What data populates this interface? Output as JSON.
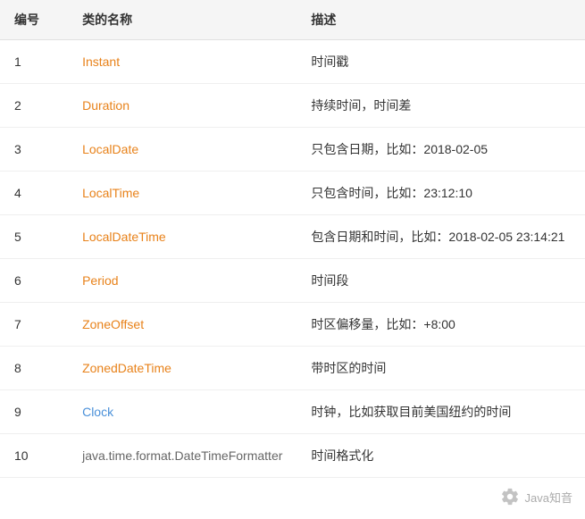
{
  "table": {
    "headers": [
      "编号",
      "类的名称",
      "描述"
    ],
    "rows": [
      {
        "id": "1",
        "class_name": "Instant",
        "class_color": "orange",
        "description": "时间戳"
      },
      {
        "id": "2",
        "class_name": "Duration",
        "class_color": "orange",
        "description": "持续时间，时间差"
      },
      {
        "id": "3",
        "class_name": "LocalDate",
        "class_color": "orange",
        "description": "只包含日期，比如：2018-02-05"
      },
      {
        "id": "4",
        "class_name": "LocalTime",
        "class_color": "orange",
        "description": "只包含时间，比如：23:12:10"
      },
      {
        "id": "5",
        "class_name": "LocalDateTime",
        "class_color": "orange",
        "description": "包含日期和时间，比如：2018-02-05 23:14:21"
      },
      {
        "id": "6",
        "class_name": "Period",
        "class_color": "orange",
        "description": "时间段"
      },
      {
        "id": "7",
        "class_name": "ZoneOffset",
        "class_color": "orange",
        "description": "时区偏移量，比如：+8:00"
      },
      {
        "id": "8",
        "class_name": "ZonedDateTime",
        "class_color": "orange",
        "description": "带时区的时间"
      },
      {
        "id": "9",
        "class_name": "Clock",
        "class_color": "blue",
        "description": "时钟，比如获取目前美国纽约的时间"
      },
      {
        "id": "10",
        "class_name": "java.time.format.DateTimeFormatter",
        "class_color": "gray",
        "description": "时间格式化"
      }
    ]
  },
  "watermark": {
    "text": "Java知音",
    "icon": "gear"
  }
}
